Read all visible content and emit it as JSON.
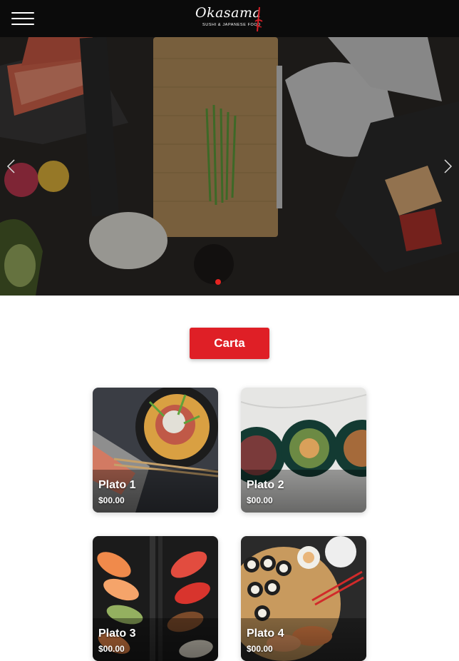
{
  "header": {
    "menu_icon": "hamburger-menu-icon",
    "logo": {
      "word": "Okasama",
      "tagline": "SUSHI & JAPANESE FOOD"
    }
  },
  "hero": {
    "prev_icon": "chevron-left-icon",
    "next_icon": "chevron-right-icon",
    "slides_total": 1,
    "active_slide": 1
  },
  "main": {
    "carta_label": "Carta",
    "dishes": [
      {
        "name": "Plato 1",
        "price": "$00.00"
      },
      {
        "name": "Plato 2",
        "price": "$00.00"
      },
      {
        "name": "Plato 3",
        "price": "$00.00"
      },
      {
        "name": "Plato 4",
        "price": "$00.00"
      }
    ]
  },
  "colors": {
    "accent": "#df1f26",
    "header_bg": "#0b0b0b",
    "page_bg": "#ffffff"
  }
}
